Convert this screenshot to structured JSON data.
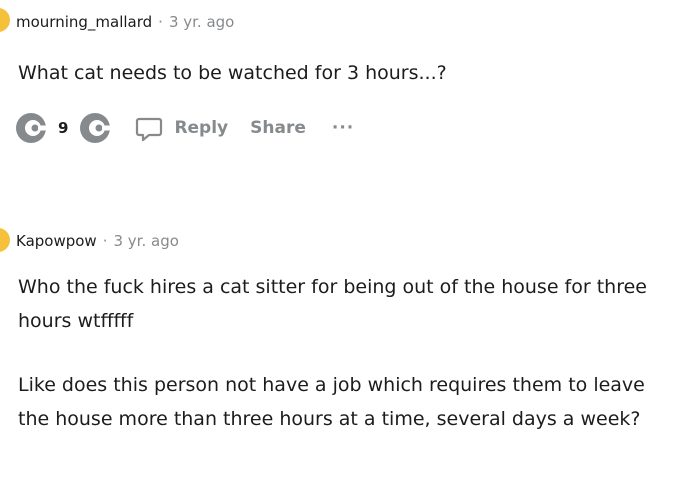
{
  "comments": [
    {
      "username": "mourning_mallard",
      "separator": "·",
      "age": "3 yr. ago",
      "body": [
        "What cat needs to be watched for 3 hours...?"
      ],
      "vote_count": "9",
      "reply_label": "Reply",
      "share_label": "Share",
      "more_label": "···"
    },
    {
      "username": "Kapowpow",
      "separator": "·",
      "age": "3 yr. ago",
      "body": [
        "Who the fuck hires a cat sitter for being out of the house for three hours wtfffff",
        "Like does this person not have a job which requires them to leave the house more than three hours at a time, several days a week?"
      ]
    }
  ],
  "colors": {
    "avatar": "#f6c13a",
    "muted": "#878a8c",
    "text": "#1c1c1c"
  }
}
